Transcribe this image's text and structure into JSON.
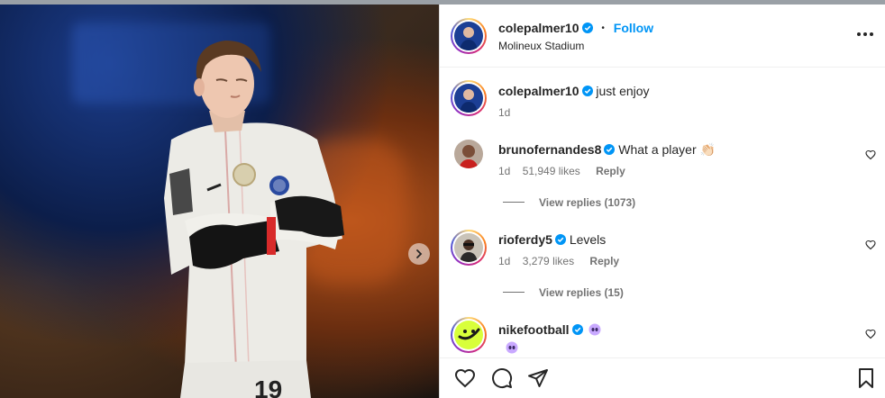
{
  "photo": {
    "next_icon": "chevron-right-icon"
  },
  "header": {
    "username": "colepalmer10",
    "separator": "•",
    "follow_label": "Follow",
    "location": "Molineux Stadium",
    "more_icon": "more-horizontal-icon"
  },
  "caption": {
    "username": "colepalmer10",
    "text": "just enjoy",
    "time": "1d"
  },
  "comments": [
    {
      "username": "brunofernandes8",
      "text": "What a player 👏🏻",
      "time": "1d",
      "likes": "51,949 likes",
      "reply_label": "Reply",
      "view_replies": "View replies (1073)"
    },
    {
      "username": "rioferdy5",
      "text": "Levels",
      "time": "1d",
      "likes": "3,279 likes",
      "reply_label": "Reply",
      "view_replies": "View replies (15)"
    },
    {
      "username": "nikefootball",
      "text": "",
      "time": "",
      "likes": "",
      "reply_label": "",
      "view_replies": ""
    }
  ],
  "actions": {
    "like_icon": "heart-icon",
    "comment_icon": "comment-icon",
    "share_icon": "send-icon",
    "save_icon": "bookmark-icon"
  },
  "colors": {
    "accent": "#0095f6",
    "verified": "#0095f6",
    "muted": "#737373",
    "text": "#262626"
  }
}
